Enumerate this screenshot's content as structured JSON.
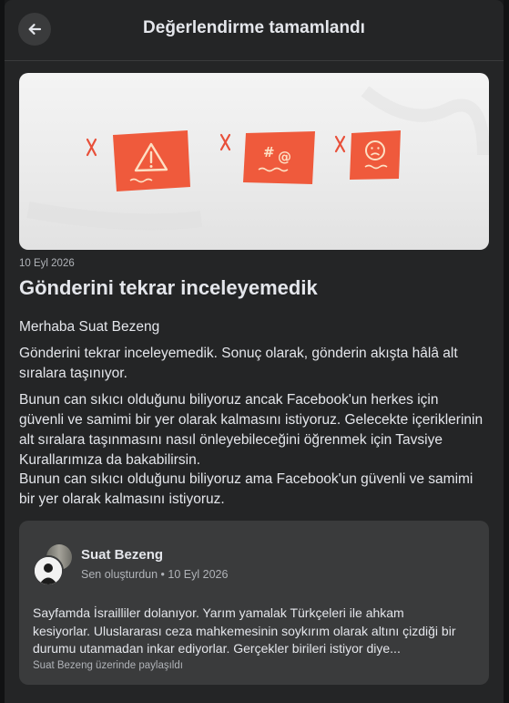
{
  "header": {
    "title": "Değerlendirme tamamlandı",
    "back_icon": "arrow-left-icon"
  },
  "hero": {
    "illustration": "three-rejected-notes",
    "icons": [
      "warning-icon",
      "profanity-icon",
      "sad-face-icon"
    ],
    "accent": "#ef5a3c"
  },
  "content": {
    "date": "10 Eyl 2026",
    "title": "Gönderini tekrar inceleyemedik",
    "greeting": "Merhaba Suat Bezeng",
    "paragraph1": "Gönderini tekrar inceleyemedik. Sonuç olarak, gönderin akışta hâlâ alt sıralara taşınıyor.",
    "paragraph2": "Bunun can sıkıcı olduğunu biliyoruz ancak Facebook'un herkes için güvenli ve samimi bir yer olarak kalmasını istiyoruz. Gelecekte içeriklerinin alt sıralara taşınmasını nasıl önleyebileceğini öğrenmek için Tavsiye Kurallarımıza da bakabilirsin.",
    "paragraph3": "Bunun can sıkıcı olduğunu biliyoruz ama Facebook'un güvenli ve samimi bir yer olarak kalmasını istiyoruz."
  },
  "post": {
    "author": "Suat Bezeng",
    "meta": "Sen oluşturdun • 10 Eyl 2026",
    "text": "Sayfamda İsrailliler dolanıyor. Yarım yamalak Türkçeleri ile ahkam kesiyorlar. Uluslararası ceza mahkemesinin soykırım olarak altını çizdiği bir durumu utanmadan inkar ediyorlar. Gerçekler birileri istiyor diye...",
    "footer": "Suat Bezeng üzerinde paylaşıldı"
  },
  "colors": {
    "background": "#242526",
    "card": "#3a3b3c",
    "text": "#e4e6eb",
    "secondary_text": "#b0b3b8"
  }
}
